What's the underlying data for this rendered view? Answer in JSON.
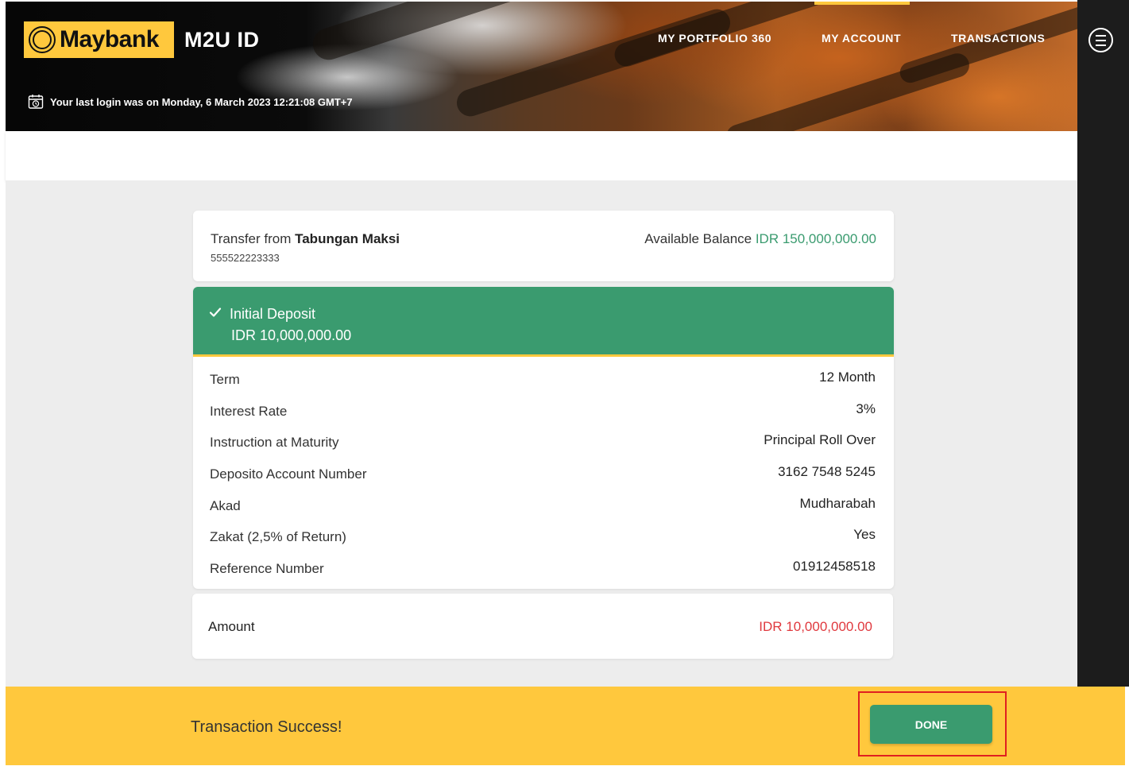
{
  "header": {
    "logo_text": "Maybank",
    "app_title": "M2U ID",
    "nav": {
      "portfolio": "MY PORTFOLIO 360",
      "account": "MY ACCOUNT",
      "transactions": "TRANSACTIONS"
    },
    "last_login": "Your last login was on Monday, 6 March 2023 12:21:08 GMT+7"
  },
  "transfer": {
    "prefix": "Transfer from ",
    "account_name": "Tabungan Maksi",
    "account_number": "555522223333",
    "balance_label": "Available Balance ",
    "balance_value": "IDR 150,000,000.00"
  },
  "deposit": {
    "title": "Initial Deposit",
    "amount": "IDR 10,000,000.00",
    "rows": [
      {
        "label": "Term",
        "value": "12 Month"
      },
      {
        "label": "Interest Rate",
        "value": "3%"
      },
      {
        "label": "Instruction at Maturity",
        "value": "Principal Roll Over"
      },
      {
        "label": "Deposito Account Number",
        "value": "3162 7548 5245"
      },
      {
        "label": "Akad",
        "value": "Mudharabah"
      },
      {
        "label": "Zakat (2,5% of Return)",
        "value": "Yes"
      },
      {
        "label": "Reference Number",
        "value": "01912458518"
      }
    ]
  },
  "amount": {
    "label": "Amount",
    "value": "IDR 10,000,000.00"
  },
  "footer": {
    "status": "Transaction Success!",
    "done_label": "DONE"
  },
  "colors": {
    "brand_yellow": "#ffc83d",
    "success_green": "#3a9b6f",
    "amount_red": "#e0393e",
    "highlight_outline": "#e02020"
  }
}
